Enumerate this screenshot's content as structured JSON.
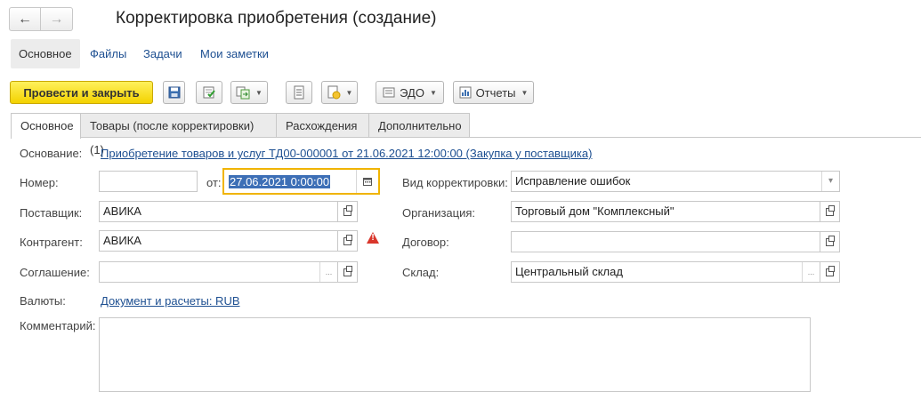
{
  "window": {
    "title": "Корректировка приобретения (создание)",
    "back_icon": "arrow-left-icon",
    "forward_icon": "arrow-right-icon"
  },
  "sections": [
    "Основное",
    "Файлы",
    "Задачи",
    "Мои заметки"
  ],
  "toolbar": {
    "post_close": "Провести и закрыть",
    "edo": "ЭДО",
    "reports": "Отчеты",
    "icons": [
      "save-icon",
      "post-icon",
      "create-based-on-icon",
      "list-icon",
      "attachment-icon",
      "edo-icon",
      "reports-icon"
    ]
  },
  "tabs": [
    "Основное",
    "Товары (после корректировки) (1)",
    "Расхождения",
    "Дополнительно"
  ],
  "form": {
    "basis_label": "Основание:",
    "basis_link": "Приобретение товаров и услуг ТД00-000001 от 21.06.2021 12:00:00 (Закупка у поставщика)",
    "number_label": "Номер:",
    "number_value": "",
    "date_label": "от:",
    "date_value": "27.06.2021  0:00:00",
    "supplier_label": "Поставщик:",
    "supplier_value": "АВИКА",
    "counterparty_label": "Контрагент:",
    "counterparty_value": "АВИКА",
    "agreement_label": "Соглашение:",
    "agreement_value": "",
    "currency_label": "Валюты:",
    "currency_link": "Документ и расчеты: RUB",
    "comment_label": "Комментарий:",
    "comment_value": "",
    "corr_type_label": "Вид корректировки:",
    "corr_type_value": "Исправление ошибок",
    "org_label": "Организация:",
    "org_value": "Торговый дом \"Комплексный\"",
    "contract_label": "Договор:",
    "contract_value": "",
    "warehouse_label": "Склад:",
    "warehouse_value": "Центральный склад",
    "select_glyph": "...",
    "dropdown_glyph": "▾",
    "warning_glyph": "!"
  },
  "colors": {
    "primary_button": "#f3d200",
    "link": "#1d4f91",
    "date_focus_border": "#f0b400",
    "date_selection": "#3d6fb6",
    "warning": "#d9362b"
  }
}
